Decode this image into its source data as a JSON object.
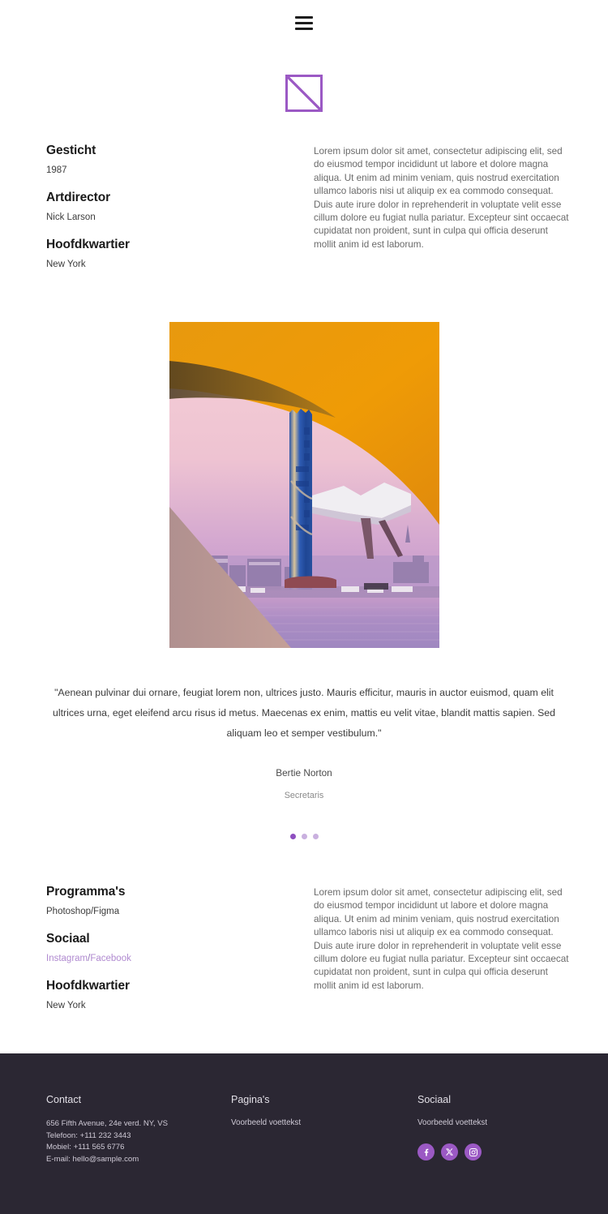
{
  "header": {
    "menu_icon": "hamburger-menu-icon"
  },
  "logo": {
    "icon": "square-diagonal-logo-icon",
    "color": "#9b59c4"
  },
  "info_top": {
    "items": [
      {
        "heading": "Gesticht",
        "value": "1987"
      },
      {
        "heading": "Artdirector",
        "value": "Nick Larson"
      },
      {
        "heading": "Hoofdkwartier",
        "value": "New York"
      }
    ],
    "paragraph": "Lorem ipsum dolor sit amet, consectetur adipiscing elit, sed do eiusmod tempor incididunt ut labore et dolore magna aliqua. Ut enim ad minim veniam, quis nostrud exercitation ullamco laboris nisi ut aliquip ex ea commodo consequat. Duis aute irure dolor in reprehenderit in voluptate velit esse cillum dolore eu fugiat nulla pariatur. Excepteur sint occaecat cupidatat non proident, sunt in culpa qui officia deserunt mollit anim id est laborum."
  },
  "hero": {
    "alt": "city-skyline-sunset-photo"
  },
  "testimonial": {
    "quote": "\"Aenean pulvinar dui ornare, feugiat lorem non, ultrices justo. Mauris efficitur, mauris in auctor euismod, quam elit ultrices urna, eget eleifend arcu risus id metus. Maecenas ex enim, mattis eu velit vitae, blandit mattis sapien. Sed aliquam leo et semper vestibulum.\"",
    "author": "Bertie Norton",
    "role": "Secretaris",
    "dots": [
      {
        "active": true
      },
      {
        "active": false
      },
      {
        "active": false
      }
    ]
  },
  "info_bottom": {
    "heading_1": "Programma's",
    "value_1": "Photoshop/Figma",
    "heading_2": "Sociaal",
    "social_link_1": "Instagram",
    "social_sep": "/",
    "social_link_2": "Facebook",
    "heading_3": "Hoofdkwartier",
    "value_3": "New York",
    "paragraph": "Lorem ipsum dolor sit amet, consectetur adipiscing elit, sed do eiusmod tempor incididunt ut labore et dolore magna aliqua. Ut enim ad minim veniam, quis nostrud exercitation ullamco laboris nisi ut aliquip ex ea commodo consequat. Duis aute irure dolor in reprehenderit in voluptate velit esse cillum dolore eu fugiat nulla pariatur. Excepteur sint occaecat cupidatat non proident, sunt in culpa qui officia deserunt mollit anim id est laborum."
  },
  "footer": {
    "background": "#2b2733",
    "contact": {
      "heading": "Contact",
      "address": "656 Fifth Avenue, 24e verd. NY, VS",
      "phone": "Telefoon: +111 232 3443",
      "mobile": "Mobiel: +111 565 6776",
      "email": "E-mail: hello@sample.com"
    },
    "pages": {
      "heading": "Pagina's",
      "text": "Voorbeeld voettekst"
    },
    "social": {
      "heading": "Sociaal",
      "text": "Voorbeeld voettekst",
      "icons": [
        "facebook-icon",
        "x-twitter-icon",
        "instagram-icon"
      ],
      "icon_color": "#9b59c4"
    }
  }
}
